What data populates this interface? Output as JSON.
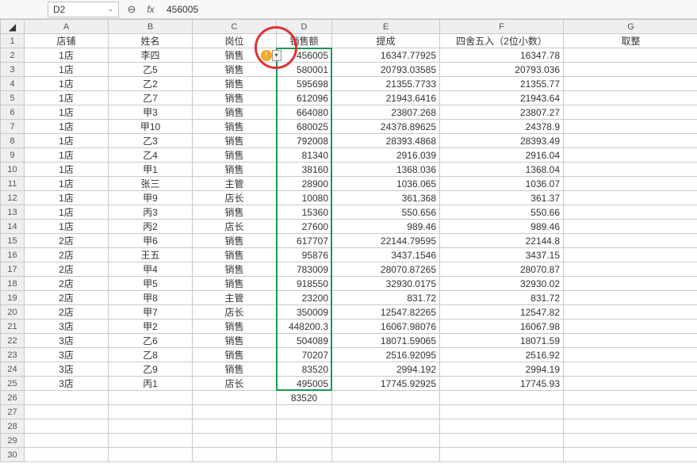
{
  "namebox": "D2",
  "formula_value": "456005",
  "columns": [
    "A",
    "B",
    "C",
    "D",
    "E",
    "F",
    "G"
  ],
  "headers": {
    "A": "店铺",
    "B": "姓名",
    "C": "岗位",
    "D": "销售额",
    "E": "提成",
    "F": "四舍五入（2位小数）",
    "G": "取整"
  },
  "rows": [
    {
      "n": 2,
      "A": "1店",
      "B": "李四",
      "C": "销售",
      "D": "456005",
      "E": "16347.77925",
      "F": "16347.78",
      "G": ""
    },
    {
      "n": 3,
      "A": "1店",
      "B": "乙5",
      "C": "销售",
      "D": "580001",
      "E": "20793.03585",
      "F": "20793.036",
      "G": ""
    },
    {
      "n": 4,
      "A": "1店",
      "B": "乙2",
      "C": "销售",
      "D": "595698",
      "E": "21355.7733",
      "F": "21355.77",
      "G": ""
    },
    {
      "n": 5,
      "A": "1店",
      "B": "乙7",
      "C": "销售",
      "D": "612096",
      "E": "21943.6416",
      "F": "21943.64",
      "G": ""
    },
    {
      "n": 6,
      "A": "1店",
      "B": "甲3",
      "C": "销售",
      "D": "664080",
      "E": "23807.268",
      "F": "23807.27",
      "G": ""
    },
    {
      "n": 7,
      "A": "1店",
      "B": "甲10",
      "C": "销售",
      "D": "680025",
      "E": "24378.89625",
      "F": "24378.9",
      "G": ""
    },
    {
      "n": 8,
      "A": "1店",
      "B": "乙3",
      "C": "销售",
      "D": "792008",
      "E": "28393.4868",
      "F": "28393.49",
      "G": ""
    },
    {
      "n": 9,
      "A": "1店",
      "B": "乙4",
      "C": "销售",
      "D": "81340",
      "E": "2916.039",
      "F": "2916.04",
      "G": ""
    },
    {
      "n": 10,
      "A": "1店",
      "B": "甲1",
      "C": "销售",
      "D": "38160",
      "E": "1368.036",
      "F": "1368.04",
      "G": ""
    },
    {
      "n": 11,
      "A": "1店",
      "B": "张三",
      "C": "主管",
      "D": "28900",
      "E": "1036.065",
      "F": "1036.07",
      "G": ""
    },
    {
      "n": 12,
      "A": "1店",
      "B": "甲9",
      "C": "店长",
      "D": "10080",
      "E": "361.368",
      "F": "361.37",
      "G": ""
    },
    {
      "n": 13,
      "A": "1店",
      "B": "丙3",
      "C": "销售",
      "D": "15360",
      "E": "550.656",
      "F": "550.66",
      "G": ""
    },
    {
      "n": 14,
      "A": "1店",
      "B": "丙2",
      "C": "店长",
      "D": "27600",
      "E": "989.46",
      "F": "989.46",
      "G": ""
    },
    {
      "n": 15,
      "A": "2店",
      "B": "甲6",
      "C": "销售",
      "D": "617707",
      "E": "22144.79595",
      "F": "22144.8",
      "G": ""
    },
    {
      "n": 16,
      "A": "2店",
      "B": "王五",
      "C": "销售",
      "D": "95876",
      "E": "3437.1546",
      "F": "3437.15",
      "G": ""
    },
    {
      "n": 17,
      "A": "2店",
      "B": "甲4",
      "C": "销售",
      "D": "783009",
      "E": "28070.87265",
      "F": "28070.87",
      "G": ""
    },
    {
      "n": 18,
      "A": "2店",
      "B": "甲5",
      "C": "销售",
      "D": "918550",
      "E": "32930.0175",
      "F": "32930.02",
      "G": ""
    },
    {
      "n": 19,
      "A": "2店",
      "B": "甲8",
      "C": "主管",
      "D": "23200",
      "E": "831.72",
      "F": "831.72",
      "G": ""
    },
    {
      "n": 20,
      "A": "2店",
      "B": "甲7",
      "C": "店长",
      "D": "350009",
      "E": "12547.82265",
      "F": "12547.82",
      "G": ""
    },
    {
      "n": 21,
      "A": "3店",
      "B": "甲2",
      "C": "销售",
      "D": "448200.3",
      "E": "16067.98076",
      "F": "16067.98",
      "G": ""
    },
    {
      "n": 22,
      "A": "3店",
      "B": "乙6",
      "C": "销售",
      "D": "504089",
      "E": "18071.59065",
      "F": "18071.59",
      "G": ""
    },
    {
      "n": 23,
      "A": "3店",
      "B": "乙8",
      "C": "销售",
      "D": "70207",
      "E": "2516.92095",
      "F": "2516.92",
      "G": ""
    },
    {
      "n": 24,
      "A": "3店",
      "B": "乙9",
      "C": "销售",
      "D": "83520",
      "E": "2994.192",
      "F": "2994.19",
      "G": ""
    },
    {
      "n": 25,
      "A": "3店",
      "B": "丙1",
      "C": "店长",
      "D": "495005",
      "E": "17745.92925",
      "F": "17745.93",
      "G": ""
    }
  ],
  "extra_rows": [
    {
      "n": 26,
      "D": "83520"
    },
    {
      "n": 27
    },
    {
      "n": 28
    },
    {
      "n": 29
    },
    {
      "n": 30
    }
  ],
  "icons": {
    "zoom_out": "⊖",
    "fx": "fx",
    "warn": "!",
    "drop": "▾"
  }
}
